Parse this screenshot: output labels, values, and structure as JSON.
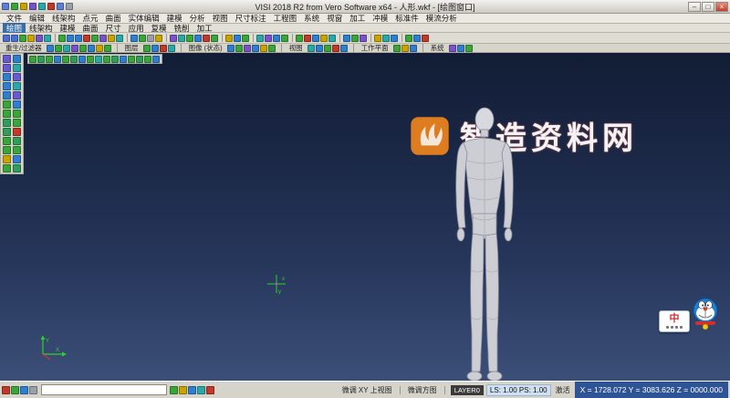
{
  "window": {
    "title": "VISI 2018 R2 from Vero Software x64 - 人形.wkf - [绘图窗口]",
    "min": "–",
    "max": "□",
    "close": "×"
  },
  "quick_icons": [
    "#5b7fd4",
    "#3aa53a",
    "#c8a400",
    "#7a52c7",
    "#2aa7a7",
    "#c0392b",
    "#5b7fd4",
    "#9aa0a8"
  ],
  "menus1": [
    "文件",
    "编辑",
    "线架构",
    "点元",
    "曲面",
    "实体编辑",
    "建模",
    "分析",
    "视图",
    "尺寸标注",
    "工程图",
    "系统",
    "视窗",
    "加工",
    "冲模",
    "标准件",
    "模流分析"
  ],
  "menus2": [
    "绘图",
    "线架构",
    "建模",
    "曲面",
    "尺寸",
    "应用",
    "复模",
    "铣削",
    "加工"
  ],
  "toolbar": {
    "c1": [
      "#4a6fd0",
      "#4a6fd0",
      "#3aa53a",
      "#c8a400",
      "#7a52c7",
      "#2aa7a7"
    ],
    "c2": [
      "#3aa53a",
      "#2f7fd0",
      "#2f7fd0",
      "#c0392b",
      "#3aa53a",
      "#7a52c7",
      "#c8a400",
      "#2aa7a7"
    ],
    "c3": [
      "#2f7fd0",
      "#3aa53a",
      "#9aa0a8",
      "#c8a400"
    ],
    "c4": [
      "#7a52c7",
      "#2aa7a7",
      "#3aa53a",
      "#2f7fd0",
      "#c0392b",
      "#3aa53a"
    ],
    "c5": [
      "#c8a400",
      "#2f7fd0",
      "#3aa53a"
    ],
    "c6": [
      "#2aa7a7",
      "#7a52c7",
      "#2f7fd0",
      "#3aa53a"
    ],
    "c7": [
      "#3aa53a",
      "#c0392b",
      "#2f7fd0",
      "#c8a400",
      "#2aa7a7"
    ],
    "c8": [
      "#2f7fd0",
      "#3aa53a",
      "#7a52c7"
    ],
    "c9": [
      "#c8a400",
      "#2aa7a7",
      "#2f7fd0"
    ],
    "c10": [
      "#3aa53a",
      "#2f7fd0",
      "#c0392b"
    ]
  },
  "tabrow": {
    "g1": {
      "label": "重生/过滤器",
      "icons": [
        "#2f7fd0",
        "#3aa53a",
        "#2aa7a7",
        "#7a52c7",
        "#3aa53a",
        "#2f7fd0",
        "#c8a400",
        "#3aa53a"
      ]
    },
    "g2": {
      "label": "图层",
      "icons": [
        "#3aa53a",
        "#2f7fd0",
        "#c0392b",
        "#2aa7a7"
      ]
    },
    "g3": {
      "label": "图像 (状态)",
      "icons": [
        "#2f7fd0",
        "#3aa53a",
        "#7a52c7",
        "#2f7fd0",
        "#c8a400",
        "#3aa53a"
      ]
    },
    "g4": {
      "label": "视图",
      "icons": [
        "#2aa7a7",
        "#2f7fd0",
        "#3aa53a",
        "#c0392b",
        "#2f7fd0"
      ]
    },
    "g5": {
      "label": "工作平面",
      "icons": [
        "#3aa53a",
        "#c8a400",
        "#2f7fd0"
      ]
    },
    "g6": {
      "label": "系统",
      "icons": [
        "#7a52c7",
        "#2f7fd0",
        "#3aa53a"
      ]
    }
  },
  "sidebar_icons": [
    "#6a5ad0",
    "#2f7fd0",
    "#6a5ad0",
    "#2aa7a7",
    "#2f7fd0",
    "#6a5ad0",
    "#2f7fd0",
    "#2aa7a7",
    "#2f7fd0",
    "#6a5ad0",
    "#3aa53a",
    "#2f7fd0",
    "#3aa53a",
    "#3aa53a",
    "#2f9e5a",
    "#3aa53a",
    "#2f9e5a",
    "#c0392b",
    "#3aa53a",
    "#2f9e5a",
    "#3aa53a",
    "#3aa53a",
    "#c8a400",
    "#2f7fd0",
    "#3aa53a",
    "#2f9e5a"
  ],
  "viewport_strip_icons": [
    "#3aa53a",
    "#2f9e5a",
    "#3aa53a",
    "#2f7fd0",
    "#3aa53a",
    "#2f9e5a",
    "#2f7fd0",
    "#3aa53a",
    "#2aa7a7",
    "#3aa53a",
    "#2f9e5a",
    "#2f7fd0",
    "#3aa53a",
    "#2f9e5a",
    "#3aa53a",
    "#2f7fd0"
  ],
  "watermark": {
    "text": "智造资料网",
    "logo_color": "#e8821e"
  },
  "axes": {
    "center_x": "x",
    "center_y": "y",
    "triad_x": "X",
    "triad_y": "Y"
  },
  "ime": {
    "char": "中"
  },
  "status": {
    "input_value": "",
    "left_icons": [
      "#c0392b",
      "#3aa53a",
      "#2f7fd0",
      "#9aa0a8"
    ],
    "mid_icons": [
      "#3aa53a",
      "#c8a400",
      "#2f7fd0",
      "#2aa7a7",
      "#c0392b"
    ],
    "mode1": "微调 XY 上视图",
    "mode2": "微调方图",
    "layer": "LAYER0",
    "scale": "LS: 1.00  PS: 1.00",
    "active": "激活",
    "coords": "X = 1728.072   Y = 3083.626   Z = 0000.000"
  }
}
